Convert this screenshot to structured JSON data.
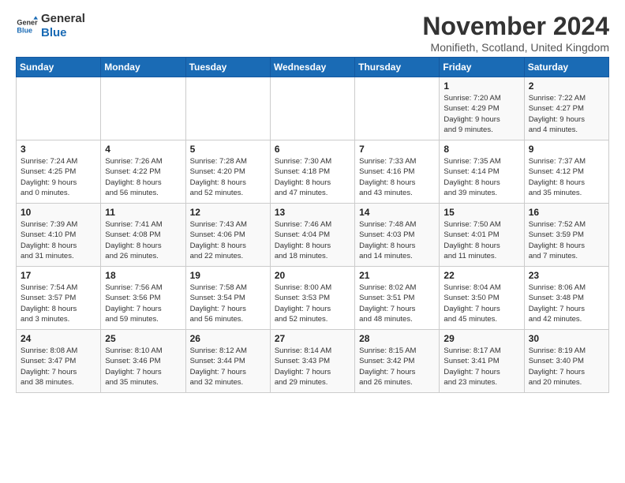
{
  "logo": {
    "line1": "General",
    "line2": "Blue"
  },
  "title": "November 2024",
  "location": "Monifieth, Scotland, United Kingdom",
  "days_of_week": [
    "Sunday",
    "Monday",
    "Tuesday",
    "Wednesday",
    "Thursday",
    "Friday",
    "Saturday"
  ],
  "weeks": [
    [
      {
        "day": "",
        "info": ""
      },
      {
        "day": "",
        "info": ""
      },
      {
        "day": "",
        "info": ""
      },
      {
        "day": "",
        "info": ""
      },
      {
        "day": "",
        "info": ""
      },
      {
        "day": "1",
        "info": "Sunrise: 7:20 AM\nSunset: 4:29 PM\nDaylight: 9 hours\nand 9 minutes."
      },
      {
        "day": "2",
        "info": "Sunrise: 7:22 AM\nSunset: 4:27 PM\nDaylight: 9 hours\nand 4 minutes."
      }
    ],
    [
      {
        "day": "3",
        "info": "Sunrise: 7:24 AM\nSunset: 4:25 PM\nDaylight: 9 hours\nand 0 minutes."
      },
      {
        "day": "4",
        "info": "Sunrise: 7:26 AM\nSunset: 4:22 PM\nDaylight: 8 hours\nand 56 minutes."
      },
      {
        "day": "5",
        "info": "Sunrise: 7:28 AM\nSunset: 4:20 PM\nDaylight: 8 hours\nand 52 minutes."
      },
      {
        "day": "6",
        "info": "Sunrise: 7:30 AM\nSunset: 4:18 PM\nDaylight: 8 hours\nand 47 minutes."
      },
      {
        "day": "7",
        "info": "Sunrise: 7:33 AM\nSunset: 4:16 PM\nDaylight: 8 hours\nand 43 minutes."
      },
      {
        "day": "8",
        "info": "Sunrise: 7:35 AM\nSunset: 4:14 PM\nDaylight: 8 hours\nand 39 minutes."
      },
      {
        "day": "9",
        "info": "Sunrise: 7:37 AM\nSunset: 4:12 PM\nDaylight: 8 hours\nand 35 minutes."
      }
    ],
    [
      {
        "day": "10",
        "info": "Sunrise: 7:39 AM\nSunset: 4:10 PM\nDaylight: 8 hours\nand 31 minutes."
      },
      {
        "day": "11",
        "info": "Sunrise: 7:41 AM\nSunset: 4:08 PM\nDaylight: 8 hours\nand 26 minutes."
      },
      {
        "day": "12",
        "info": "Sunrise: 7:43 AM\nSunset: 4:06 PM\nDaylight: 8 hours\nand 22 minutes."
      },
      {
        "day": "13",
        "info": "Sunrise: 7:46 AM\nSunset: 4:04 PM\nDaylight: 8 hours\nand 18 minutes."
      },
      {
        "day": "14",
        "info": "Sunrise: 7:48 AM\nSunset: 4:03 PM\nDaylight: 8 hours\nand 14 minutes."
      },
      {
        "day": "15",
        "info": "Sunrise: 7:50 AM\nSunset: 4:01 PM\nDaylight: 8 hours\nand 11 minutes."
      },
      {
        "day": "16",
        "info": "Sunrise: 7:52 AM\nSunset: 3:59 PM\nDaylight: 8 hours\nand 7 minutes."
      }
    ],
    [
      {
        "day": "17",
        "info": "Sunrise: 7:54 AM\nSunset: 3:57 PM\nDaylight: 8 hours\nand 3 minutes."
      },
      {
        "day": "18",
        "info": "Sunrise: 7:56 AM\nSunset: 3:56 PM\nDaylight: 7 hours\nand 59 minutes."
      },
      {
        "day": "19",
        "info": "Sunrise: 7:58 AM\nSunset: 3:54 PM\nDaylight: 7 hours\nand 56 minutes."
      },
      {
        "day": "20",
        "info": "Sunrise: 8:00 AM\nSunset: 3:53 PM\nDaylight: 7 hours\nand 52 minutes."
      },
      {
        "day": "21",
        "info": "Sunrise: 8:02 AM\nSunset: 3:51 PM\nDaylight: 7 hours\nand 48 minutes."
      },
      {
        "day": "22",
        "info": "Sunrise: 8:04 AM\nSunset: 3:50 PM\nDaylight: 7 hours\nand 45 minutes."
      },
      {
        "day": "23",
        "info": "Sunrise: 8:06 AM\nSunset: 3:48 PM\nDaylight: 7 hours\nand 42 minutes."
      }
    ],
    [
      {
        "day": "24",
        "info": "Sunrise: 8:08 AM\nSunset: 3:47 PM\nDaylight: 7 hours\nand 38 minutes."
      },
      {
        "day": "25",
        "info": "Sunrise: 8:10 AM\nSunset: 3:46 PM\nDaylight: 7 hours\nand 35 minutes."
      },
      {
        "day": "26",
        "info": "Sunrise: 8:12 AM\nSunset: 3:44 PM\nDaylight: 7 hours\nand 32 minutes."
      },
      {
        "day": "27",
        "info": "Sunrise: 8:14 AM\nSunset: 3:43 PM\nDaylight: 7 hours\nand 29 minutes."
      },
      {
        "day": "28",
        "info": "Sunrise: 8:15 AM\nSunset: 3:42 PM\nDaylight: 7 hours\nand 26 minutes."
      },
      {
        "day": "29",
        "info": "Sunrise: 8:17 AM\nSunset: 3:41 PM\nDaylight: 7 hours\nand 23 minutes."
      },
      {
        "day": "30",
        "info": "Sunrise: 8:19 AM\nSunset: 3:40 PM\nDaylight: 7 hours\nand 20 minutes."
      }
    ]
  ]
}
